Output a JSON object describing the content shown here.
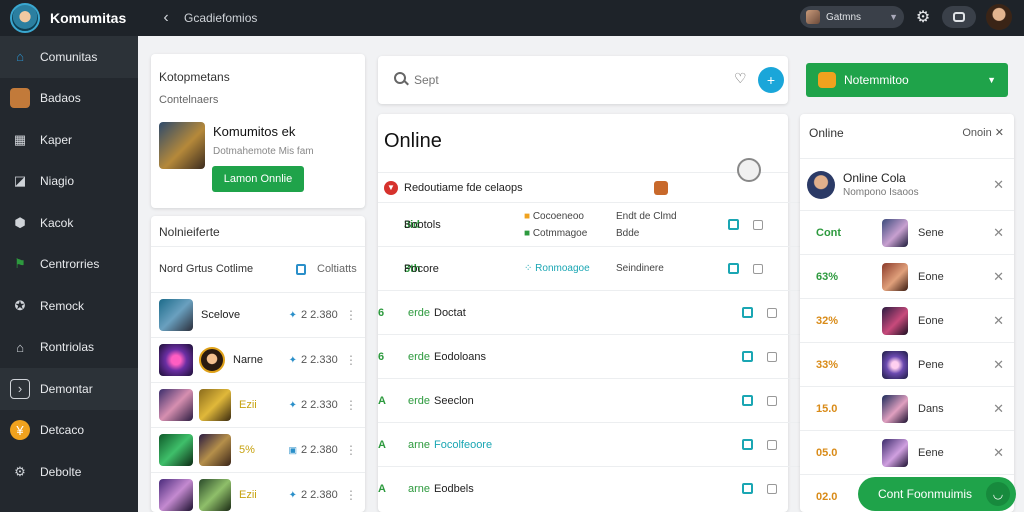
{
  "app": {
    "title": "Komumitas",
    "breadcrumb": "Gcadiefomios"
  },
  "top": {
    "profile_label": "Gatmns"
  },
  "sidebar": {
    "items": [
      {
        "label": "Comunitas",
        "icon": "home-icon",
        "color": "#2a8fc9"
      },
      {
        "label": "Badaos",
        "icon": "avatar-icon",
        "color": "#c27a3a"
      },
      {
        "label": "Kaper",
        "icon": "grid-icon",
        "color": "#9aa0a6"
      },
      {
        "label": "Niagio",
        "icon": "chart-icon",
        "color": "#9aa0a6"
      },
      {
        "label": "Kacok",
        "icon": "shield-icon",
        "color": "#9aa0a6"
      },
      {
        "label": "Centrorries",
        "icon": "flag-icon",
        "color": "#2d9a3e"
      },
      {
        "label": "Remock",
        "icon": "gamepad-icon",
        "color": "#9aa0a6"
      },
      {
        "label": "Rontriolas",
        "icon": "house-icon",
        "color": "#9aa0a6"
      },
      {
        "label": "Demontar",
        "icon": "terminal-icon",
        "color": "#9aa0a6"
      },
      {
        "label": "Detcaco",
        "icon": "coin-icon",
        "color": "#f0a21e"
      },
      {
        "label": "Debolte",
        "icon": "gear-icon",
        "color": "#9aa0a6"
      }
    ]
  },
  "card": {
    "title": "Kotopmetans",
    "subtitle": "Contelnaers",
    "game_title": "Komumitos ek",
    "game_sub": "Dotmahemote Mis fam",
    "button_label": "Lamon Onnlie"
  },
  "list": {
    "title": "Nolnieiferte",
    "header_left": "Nord Grtus Cotlime",
    "header_right": "Coltiatts",
    "rows": [
      {
        "name": "Scelove",
        "value": "2 2.380"
      },
      {
        "name": "Narne",
        "value": "2 2.330"
      },
      {
        "name": "Ezii",
        "value": "2 2.330"
      },
      {
        "name": "5% ",
        "value": "2 2.380"
      },
      {
        "name": "Ezii",
        "value": "2 2.380"
      }
    ]
  },
  "search": {
    "placeholder": "Sept"
  },
  "center": {
    "title": "Online",
    "header": "Redoutiame fde celaops",
    "rows": [
      {
        "num": "3id",
        "tag": "",
        "name": "Bootols",
        "mid1": "Cocoeneoo",
        "mid2": "Cotmmagoe",
        "right1": "Endt de Clmd",
        "right2": "Bdde"
      },
      {
        "num": "3th",
        "tag": "",
        "name": "Pocore",
        "mid1": "Ronmoagoe",
        "mid2": "",
        "right1": "Seindinere",
        "right2": ""
      },
      {
        "num": "6",
        "tag": "erde",
        "name": "Doctat",
        "mid1": "",
        "mid2": "",
        "right1": "",
        "right2": ""
      },
      {
        "num": "6",
        "tag": "erde",
        "name": "Eodoloans",
        "mid1": "",
        "mid2": "",
        "right1": "",
        "right2": ""
      },
      {
        "num": "A",
        "tag": "erde",
        "name": "Seeclon",
        "mid1": "",
        "mid2": "",
        "right1": "",
        "right2": ""
      },
      {
        "num": "A",
        "tag": "arne",
        "name": "Focolfeoore",
        "mid1": "",
        "mid2": "",
        "right1": "",
        "right2": ""
      },
      {
        "num": "A",
        "tag": "arne",
        "name": "Eodbels",
        "mid1": "",
        "mid2": "",
        "right1": "",
        "right2": ""
      }
    ]
  },
  "right": {
    "button_label": "Notemmitoo",
    "panel_title": "Online",
    "panel_right": "Onoin",
    "profile_name": "Online Cola",
    "profile_sub": "Nompono Isaoos",
    "rows": [
      {
        "value": "Cont",
        "name": "Sene",
        "tone": "green"
      },
      {
        "value": "63%",
        "name": "Eone",
        "tone": "green"
      },
      {
        "value": "32%",
        "name": "Eone",
        "tone": "orange"
      },
      {
        "value": "33%",
        "name": "Pene",
        "tone": "orange"
      },
      {
        "value": "15.0",
        "name": "Dans",
        "tone": "orange"
      },
      {
        "value": "05.0",
        "name": "Eene",
        "tone": "orange"
      },
      {
        "value": "02.0",
        "name": "",
        "tone": "orange"
      }
    ]
  },
  "float_button": {
    "label": "Cont Foonmuimis"
  }
}
